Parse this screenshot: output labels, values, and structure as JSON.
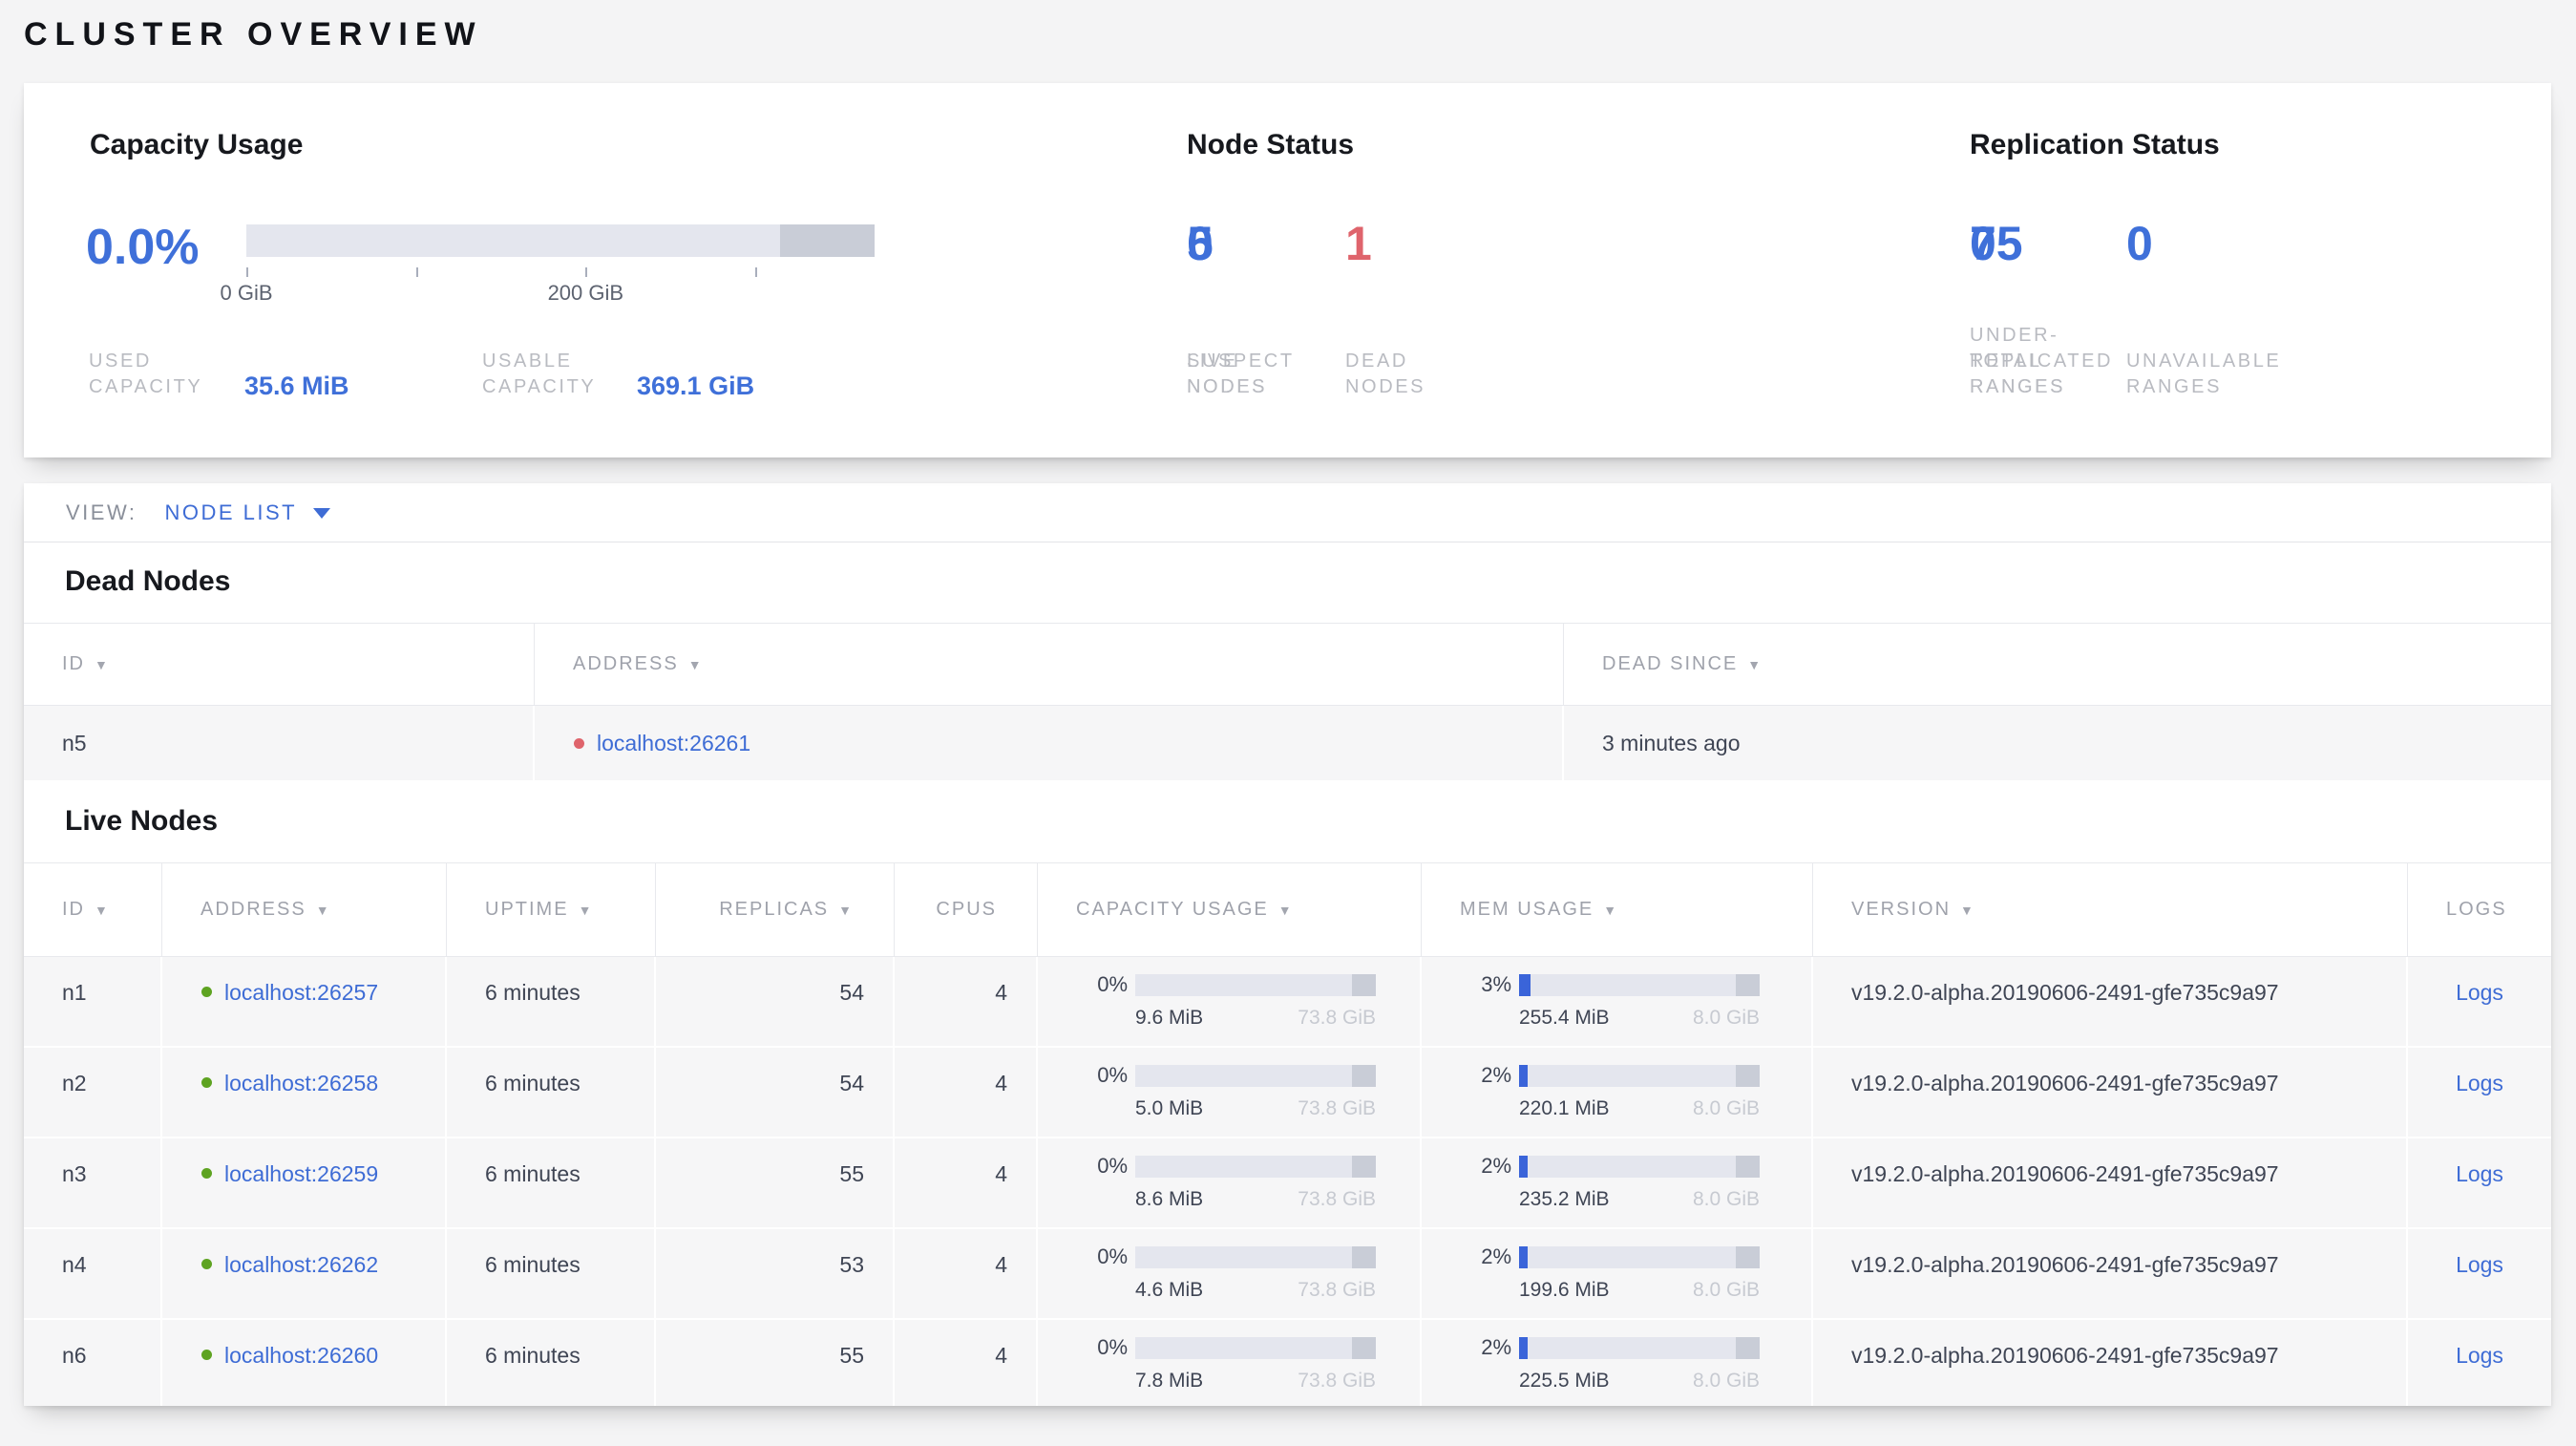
{
  "page_title": "CLUSTER OVERVIEW",
  "colors": {
    "accent_blue": "#3e6cd5",
    "dead_red": "#df646c",
    "live_green": "#5ea321",
    "bar_track": "#e4e6ee",
    "bar_reserved": "#c9cdd7",
    "bar_fill": "#3a64d9"
  },
  "summary": {
    "capacity_usage": {
      "title": "Capacity Usage",
      "percent": "0.0%",
      "tick_labels": [
        "0 GiB",
        "200 GiB"
      ],
      "used": {
        "label_lines": [
          "USED",
          "CAPACITY"
        ],
        "value": "35.6 MiB"
      },
      "usable": {
        "label_lines": [
          "USABLE",
          "CAPACITY"
        ],
        "value": "369.1 GiB"
      }
    },
    "node_status": {
      "title": "Node Status",
      "stats": [
        {
          "value": "5",
          "label_lines": [
            "LIVE",
            "NODES"
          ],
          "tone": "blue"
        },
        {
          "value": "0",
          "label_lines": [
            "SUSPECT",
            "NODES"
          ],
          "tone": "blue"
        },
        {
          "value": "1",
          "label_lines": [
            "DEAD",
            "NODES"
          ],
          "tone": "red"
        }
      ]
    },
    "replication_status": {
      "title": "Replication Status",
      "stats": [
        {
          "value": "75",
          "label_lines": [
            "TOTAL",
            "RANGES"
          ],
          "tone": "blue"
        },
        {
          "value": "0",
          "label_lines": [
            "UNDER-",
            "REPLICATED",
            "RANGES"
          ],
          "tone": "blue"
        },
        {
          "value": "0",
          "label_lines": [
            "UNAVAILABLE",
            "RANGES"
          ],
          "tone": "blue"
        }
      ]
    }
  },
  "view_bar": {
    "label": "VIEW:",
    "selected": "NODE LIST"
  },
  "dead_nodes": {
    "title": "Dead Nodes",
    "columns": [
      "ID",
      "ADDRESS",
      "DEAD SINCE"
    ],
    "rows": [
      {
        "id": "n5",
        "address": "localhost:26261",
        "dead_since": "3 minutes ago"
      }
    ]
  },
  "live_nodes": {
    "title": "Live Nodes",
    "columns": [
      "ID",
      "ADDRESS",
      "UPTIME",
      "REPLICAS",
      "CPUS",
      "CAPACITY USAGE",
      "MEM USAGE",
      "VERSION",
      "LOGS"
    ],
    "rows": [
      {
        "id": "n1",
        "address": "localhost:26257",
        "uptime": "6 minutes",
        "replicas": "54",
        "cpus": "4",
        "capacity_percent": "0%",
        "capacity_fill": 0,
        "capacity_used": "9.6 MiB",
        "capacity_total": "73.8 GiB",
        "mem_percent": "3%",
        "mem_fill": 3,
        "mem_used": "255.4 MiB",
        "mem_total": "8.0 GiB",
        "version": "v19.2.0-alpha.20190606-2491-gfe735c9a97",
        "logs_label": "Logs"
      },
      {
        "id": "n2",
        "address": "localhost:26258",
        "uptime": "6 minutes",
        "replicas": "54",
        "cpus": "4",
        "capacity_percent": "0%",
        "capacity_fill": 0,
        "capacity_used": "5.0 MiB",
        "capacity_total": "73.8 GiB",
        "mem_percent": "2%",
        "mem_fill": 2,
        "mem_used": "220.1 MiB",
        "mem_total": "8.0 GiB",
        "version": "v19.2.0-alpha.20190606-2491-gfe735c9a97",
        "logs_label": "Logs"
      },
      {
        "id": "n3",
        "address": "localhost:26259",
        "uptime": "6 minutes",
        "replicas": "55",
        "cpus": "4",
        "capacity_percent": "0%",
        "capacity_fill": 0,
        "capacity_used": "8.6 MiB",
        "capacity_total": "73.8 GiB",
        "mem_percent": "2%",
        "mem_fill": 2,
        "mem_used": "235.2 MiB",
        "mem_total": "8.0 GiB",
        "version": "v19.2.0-alpha.20190606-2491-gfe735c9a97",
        "logs_label": "Logs"
      },
      {
        "id": "n4",
        "address": "localhost:26262",
        "uptime": "6 minutes",
        "replicas": "53",
        "cpus": "4",
        "capacity_percent": "0%",
        "capacity_fill": 0,
        "capacity_used": "4.6 MiB",
        "capacity_total": "73.8 GiB",
        "mem_percent": "2%",
        "mem_fill": 2,
        "mem_used": "199.6 MiB",
        "mem_total": "8.0 GiB",
        "version": "v19.2.0-alpha.20190606-2491-gfe735c9a97",
        "logs_label": "Logs"
      },
      {
        "id": "n6",
        "address": "localhost:26260",
        "uptime": "6 minutes",
        "replicas": "55",
        "cpus": "4",
        "capacity_percent": "0%",
        "capacity_fill": 0,
        "capacity_used": "7.8 MiB",
        "capacity_total": "73.8 GiB",
        "mem_percent": "2%",
        "mem_fill": 2,
        "mem_used": "225.5 MiB",
        "mem_total": "8.0 GiB",
        "version": "v19.2.0-alpha.20190606-2491-gfe735c9a97",
        "logs_label": "Logs"
      }
    ]
  }
}
